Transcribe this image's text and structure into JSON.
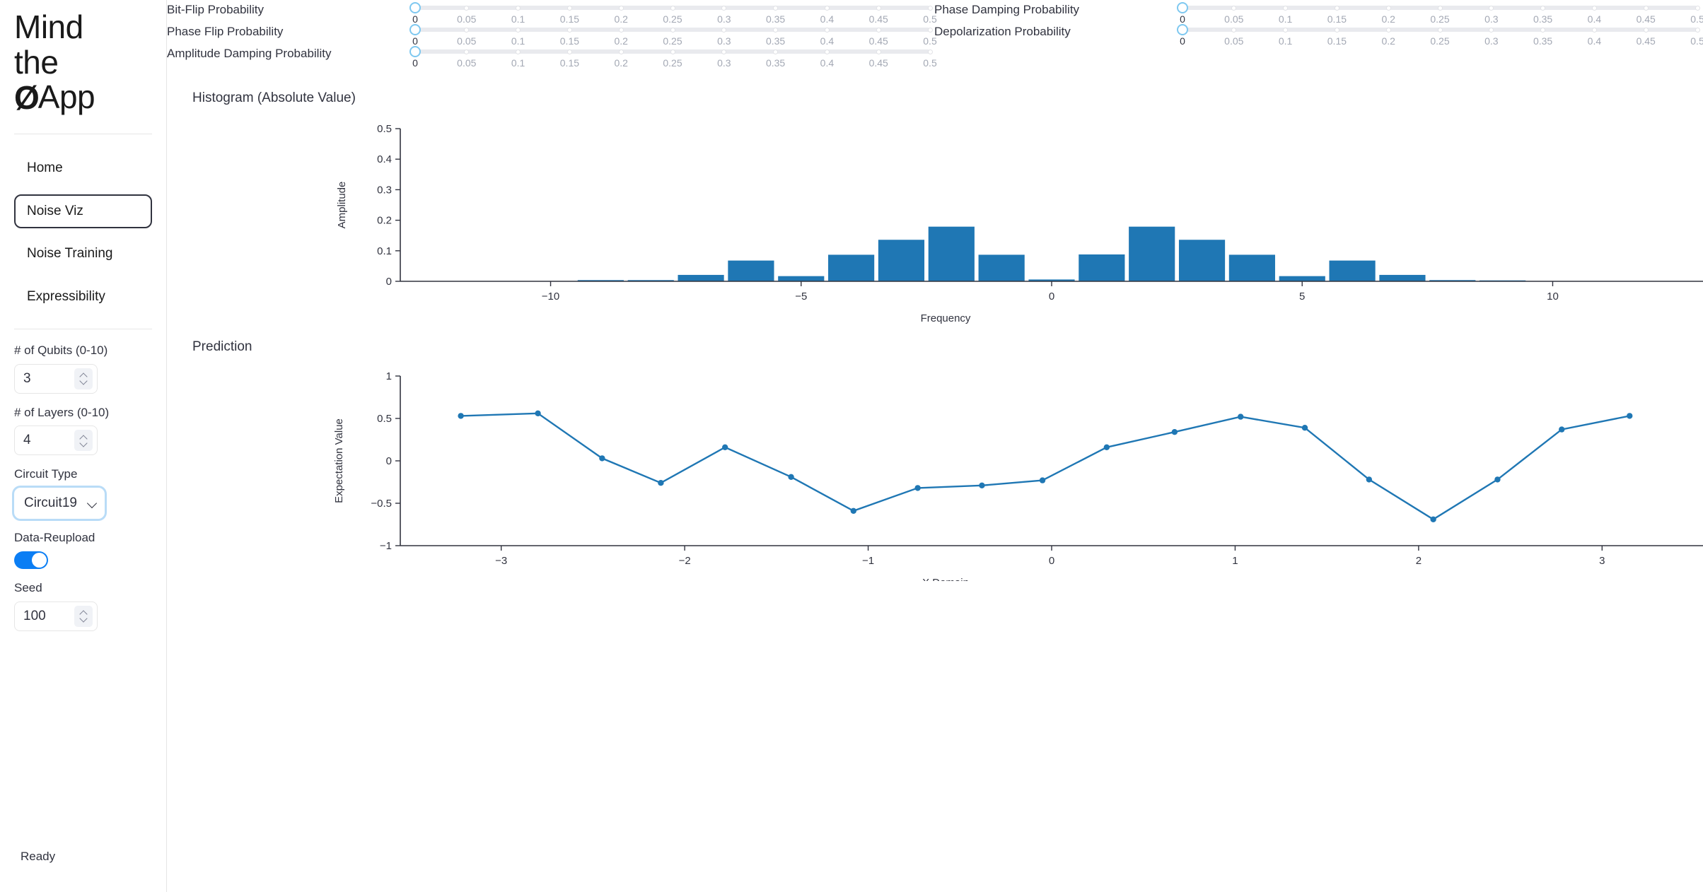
{
  "sidebar": {
    "logo": {
      "line1": "Mind",
      "line2": "the",
      "q": "Ø",
      "line3": "App"
    },
    "nav": [
      {
        "label": "Home",
        "active": false
      },
      {
        "label": "Noise Viz",
        "active": true
      },
      {
        "label": "Noise Training",
        "active": false
      },
      {
        "label": "Expressibility",
        "active": false
      }
    ],
    "qubits": {
      "label": "# of Qubits (0-10)",
      "value": "3"
    },
    "layers": {
      "label": "# of Layers (0-10)",
      "value": "4"
    },
    "circuit_type": {
      "label": "Circuit Type",
      "value": "Circuit19"
    },
    "data_reupload": {
      "label": "Data-Reupload",
      "on": true
    },
    "seed": {
      "label": "Seed",
      "value": "100"
    },
    "status": "Ready"
  },
  "sliders": {
    "tick_labels": [
      "0",
      "0.05",
      "0.1",
      "0.15",
      "0.2",
      "0.25",
      "0.3",
      "0.35",
      "0.4",
      "0.45",
      "0.5"
    ],
    "left": [
      {
        "label": "Bit-Flip Probability",
        "value": "0"
      },
      {
        "label": "Phase Flip Probability",
        "value": "0"
      },
      {
        "label": "Amplitude Damping Probability",
        "value": "0"
      }
    ],
    "right": [
      {
        "label": "Phase Damping Probability",
        "value": "0"
      },
      {
        "label": "Depolarization Probability",
        "value": "0"
      }
    ]
  },
  "chart_data": [
    {
      "type": "bar",
      "title": "Histogram (Absolute Value)",
      "xlabel": "Frequency",
      "ylabel": "Amplitude",
      "xlim": [
        -13,
        13
      ],
      "ylim": [
        0,
        0.5
      ],
      "xticks": [
        -10,
        -5,
        0,
        5,
        10
      ],
      "yticks": [
        0,
        0.1,
        0.2,
        0.3,
        0.4,
        0.5
      ],
      "ytick_labels": [
        "0",
        "0.1",
        "0.2",
        "0.3",
        "0.4",
        "0.5"
      ],
      "xtick_labels": [
        "−10",
        "−5",
        "0",
        "5",
        "10"
      ],
      "grid": false,
      "categories": [
        -12,
        -11,
        -10,
        -9,
        -8,
        -7,
        -6,
        -5,
        -4,
        -3,
        -2,
        -1,
        0,
        1,
        2,
        3,
        4,
        5,
        6,
        7,
        8,
        9,
        10,
        11,
        12
      ],
      "values": [
        0,
        0,
        0,
        0.004,
        0.004,
        0.021,
        0.068,
        0.017,
        0.087,
        0.136,
        0.179,
        0.087,
        0.006,
        0.088,
        0.179,
        0.136,
        0.087,
        0.017,
        0.068,
        0.021,
        0.004,
        0.003,
        0,
        0,
        0
      ]
    },
    {
      "type": "line",
      "title": "Prediction",
      "xlabel": "X Domain",
      "ylabel": "Expectation Value",
      "xlim": [
        -3.55,
        3.55
      ],
      "ylim": [
        -1,
        1
      ],
      "xticks": [
        -3,
        -2,
        -1,
        0,
        1,
        2,
        3
      ],
      "yticks": [
        -1,
        -0.5,
        0,
        0.5,
        1
      ],
      "ytick_labels": [
        "−1",
        "−0.5",
        "0",
        "0.5",
        "1"
      ],
      "xtick_labels": [
        "−3",
        "−2",
        "−1",
        "0",
        "1",
        "2",
        "3"
      ],
      "grid": false,
      "marker": "circle",
      "x": [
        -3.22,
        -2.8,
        -2.45,
        -2.13,
        -1.78,
        -1.42,
        -1.08,
        -0.73,
        -0.38,
        -0.05,
        0.3,
        0.67,
        1.03,
        1.38,
        1.73,
        2.08,
        2.43,
        2.78,
        3.15
      ],
      "y": [
        0.53,
        0.56,
        0.03,
        -0.26,
        0.16,
        -0.19,
        -0.59,
        -0.32,
        -0.29,
        -0.23,
        0.16,
        0.34,
        0.52,
        0.39,
        -0.22,
        -0.69,
        -0.22,
        0.37,
        0.53
      ]
    }
  ]
}
